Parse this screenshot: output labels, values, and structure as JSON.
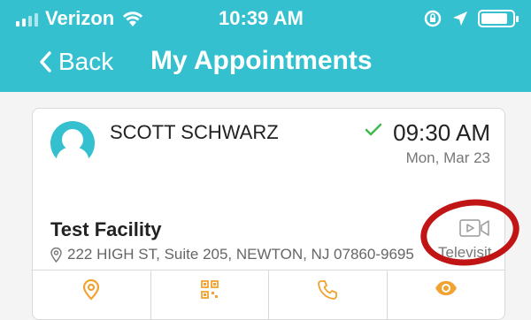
{
  "status_bar": {
    "carrier": "Verizon",
    "time": "10:39 AM",
    "battery_level": 0.85,
    "icons": [
      "signal-icon",
      "wifi-icon",
      "rotation-lock-icon",
      "location-icon",
      "battery-icon"
    ]
  },
  "nav": {
    "back_label": "Back",
    "title": "My Appointments"
  },
  "appointment": {
    "patient_name": "SCOTT SCHWARZ",
    "time": "09:30 AM",
    "date": "Mon, Mar 23",
    "facility": "Test Facility",
    "address": "222 HIGH ST, Suite 205, NEWTON, NJ 07860-9695",
    "visit_type": "Televisit",
    "status_icon": "check-icon"
  },
  "actions": [
    "location-pin-icon",
    "qr-code-icon",
    "phone-icon",
    "eye-icon"
  ],
  "colors": {
    "header": "#35c0cf",
    "accent_orange": "#f2a230",
    "confirm_green": "#3dbb4d",
    "annotation_red": "#c11414"
  }
}
